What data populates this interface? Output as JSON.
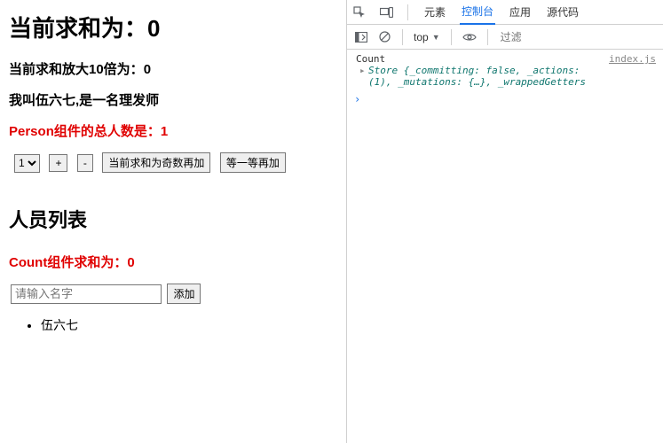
{
  "count": {
    "title_prefix": "当前求和为：",
    "title_value": "0",
    "big_prefix": "当前求和放大10倍为：",
    "big_value": "0",
    "intro": "我叫伍六七,是一名理发师",
    "person_total_prefix": "Person组件的总人数是：",
    "person_total_value": "1",
    "select_value": "1",
    "btn_plus": "+",
    "btn_minus": "-",
    "btn_odd": "当前求和为奇数再加",
    "btn_wait": "等一等再加"
  },
  "person": {
    "heading": "人员列表",
    "count_sum_prefix": "Count组件求和为：",
    "count_sum_value": "0",
    "input_placeholder": "请输入名字",
    "btn_add": "添加",
    "list": {
      "0": "伍六七"
    }
  },
  "devtools": {
    "tabs": {
      "elements": "元素",
      "console": "控制台",
      "application": "应用",
      "sources": "源代码"
    },
    "bar": {
      "context": "top",
      "filter_placeholder": "过滤"
    },
    "log": {
      "label": "Count",
      "source": "index.js",
      "store_line1": "Store {_committing: false, _actions: ",
      "store_line2": "(1), _mutations: {…}, _wrappedGetters"
    }
  }
}
